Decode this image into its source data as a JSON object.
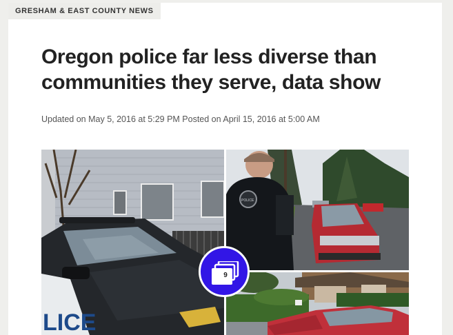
{
  "section": {
    "label": "GRESHAM & EAST COUNTY NEWS"
  },
  "article": {
    "headline": "Oregon police far less diverse than communities they serve, data show",
    "dateline": "Updated on May 5, 2016 at 5:29 PM Posted on April 15, 2016 at 5:00 AM"
  },
  "gallery": {
    "photo_count": "9",
    "badge_icon": "photo-stack-icon",
    "badge_color": "#3216e6",
    "photos": [
      {
        "name": "police-car-photo",
        "car_decal": "LICE"
      },
      {
        "name": "officer-street-photo",
        "patch_text": "POLICE"
      },
      {
        "name": "red-car-photo"
      }
    ]
  }
}
